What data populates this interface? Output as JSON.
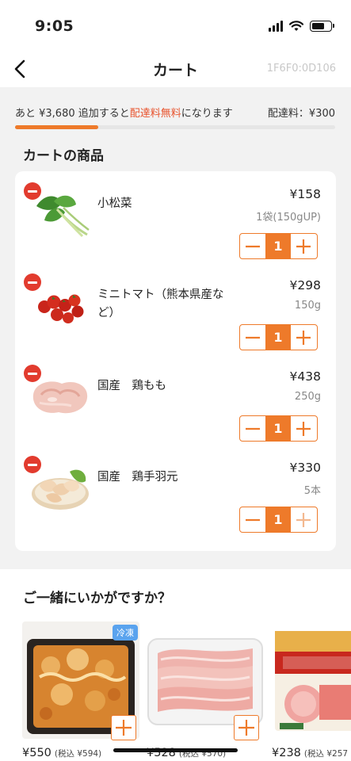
{
  "status_bar": {
    "time": "9:05"
  },
  "nav": {
    "title": "カート",
    "id_text": "1F6F0:0D106"
  },
  "shipping": {
    "message_prefix": "あと ¥3,680 追加すると",
    "message_highlight": "配達料無料",
    "message_suffix": "になります",
    "fee": "配達料：¥300",
    "progress_fraction": 0.26,
    "accent_color": "#ee7a2a",
    "highlight_color": "#e8542e"
  },
  "cart": {
    "title": "カートの商品",
    "items": [
      {
        "name": "小松菜",
        "price": "¥158",
        "unit": "1袋(150gUP)",
        "qty": "1",
        "image": "komatsuna-image"
      },
      {
        "name": "ミニトマト（熊本県産など）",
        "price": "¥298",
        "unit": "150g",
        "qty": "1",
        "image": "cherry-tomato-image"
      },
      {
        "name": "国産　鶏もも",
        "price": "¥438",
        "unit": "250g",
        "qty": "1",
        "image": "chicken-thigh-image"
      },
      {
        "name": "国産　鶏手羽元",
        "price": "¥330",
        "unit": "5本",
        "qty": "1",
        "image": "chicken-drumette-image"
      }
    ]
  },
  "suggestions": {
    "title": "ご一緒にいかがですか？",
    "items": [
      {
        "price": "¥550",
        "tax_price": "(税込 ¥594)",
        "badge": "冷凍",
        "image": "gratin-image"
      },
      {
        "price": "¥528",
        "tax_price": "(税込 ¥570)",
        "image": "pork-slices-image"
      },
      {
        "price": "¥238",
        "tax_price": "(税込 ¥257",
        "image": "roast-ham-image"
      }
    ]
  },
  "icons": {
    "back": "chevron-left-icon",
    "remove": "minus-circle-icon",
    "minus": "minus-icon",
    "plus": "plus-icon"
  }
}
